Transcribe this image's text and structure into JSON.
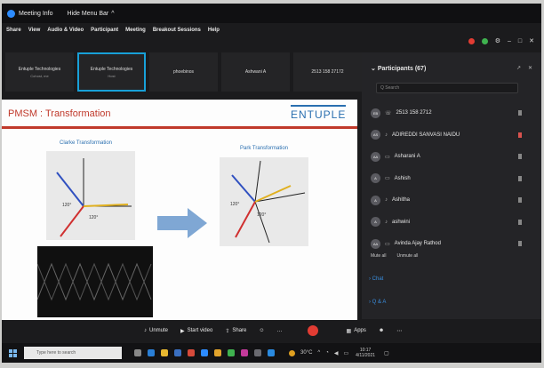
{
  "window": {
    "title": "Meeting Info",
    "hide_menu": "Hide Menu Bar"
  },
  "menu": [
    "Share",
    "View",
    "Audio & Video",
    "Participant",
    "Meeting",
    "Breakout Sessions",
    "Help"
  ],
  "tiles": [
    {
      "name": "Entuple Technologies",
      "sub": "Cohost, me",
      "active": false
    },
    {
      "name": "Entuple Technologies",
      "sub": "Host",
      "active": true
    },
    {
      "name": "phoebinos",
      "sub": "",
      "active": false
    },
    {
      "name": "Ashwani A",
      "sub": "",
      "active": false
    },
    {
      "name": "2513 158 27172",
      "sub": "",
      "active": false
    }
  ],
  "slide": {
    "title": "PMSM : Transformation",
    "logo": "ENTUPLE",
    "clarke_caption": "Clarke Transformation",
    "park_caption": "Park Transformation",
    "angle_120": "120°"
  },
  "participants": {
    "header": "Participants (67)",
    "search_placeholder": "Q Search",
    "list": [
      {
        "initials": "EB",
        "name": "2513 158 2712",
        "icon": "phone",
        "mic_red": false
      },
      {
        "initials": "AS",
        "name": "ADIREDDI SANVASI NAIDU",
        "icon": "mic",
        "mic_red": true
      },
      {
        "initials": "AA",
        "name": "Asharani A",
        "icon": "monitor",
        "mic_red": false
      },
      {
        "initials": "A",
        "name": "Ashish",
        "icon": "monitor",
        "mic_red": false
      },
      {
        "initials": "A",
        "name": "Ashitha",
        "icon": "mic",
        "mic_red": false
      },
      {
        "initials": "A",
        "name": "ashwini",
        "icon": "mic",
        "mic_red": false
      },
      {
        "initials": "AA",
        "name": "Avinda Ajay Rathod",
        "icon": "monitor",
        "mic_red": false
      }
    ],
    "mute_all": "Mute all",
    "unmute_all": "Unmute all"
  },
  "sections": {
    "chat": "Chat",
    "qa": "Q & A"
  },
  "toolbar": {
    "unmute": "Unmute",
    "start_video": "Start video",
    "share": "Share",
    "apps": "Apps"
  },
  "taskbar": {
    "search_placeholder": "Type here to search",
    "temp": "30°C",
    "time": "10:17",
    "date": "4/11/2021"
  },
  "colors": {
    "accent": "#2d8cff",
    "slide_red": "#c0392b",
    "leave_red": "#e23c33",
    "tile_active": "#18a0d8"
  }
}
